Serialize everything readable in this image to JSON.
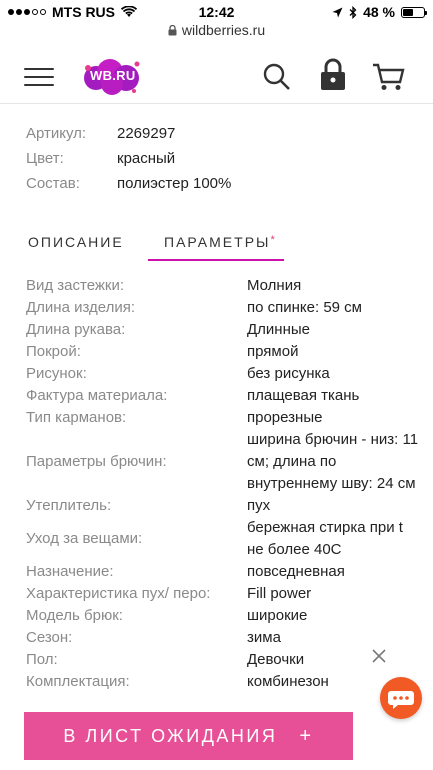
{
  "status_bar": {
    "carrier": "MTS RUS",
    "time": "12:42",
    "battery": "48 %",
    "battery_level": 0.48
  },
  "browser": {
    "url": "wildberries.ru"
  },
  "header": {
    "logo_text": "WB.RU"
  },
  "specs": [
    {
      "label": "Артикул:",
      "value": "2269297"
    },
    {
      "label": "Цвет:",
      "value": "красный"
    },
    {
      "label": "Состав:",
      "value": "полиэстер 100%"
    }
  ],
  "tabs": {
    "description": "ОПИСАНИЕ",
    "parameters": "ПАРАМЕТРЫ",
    "parameters_marker": "*"
  },
  "params": [
    {
      "label": "Вид застежки:",
      "value": "Молния"
    },
    {
      "label": "Длина изделия:",
      "value": "по спинке: 59 см"
    },
    {
      "label": "Длина рукава:",
      "value": "Длинные"
    },
    {
      "label": "Покрой:",
      "value": "прямой"
    },
    {
      "label": "Рисунок:",
      "value": "без рисунка"
    },
    {
      "label": "Фактура материала:",
      "value": "плащевая ткань"
    },
    {
      "label": "Тип карманов:",
      "value": "прорезные"
    },
    {
      "label": "Параметры брючин:",
      "value": "ширина брючин - низ: 11 см; длина по внутреннему шву: 24 см"
    },
    {
      "label": "Утеплитель:",
      "value": "пух"
    },
    {
      "label": "Уход за вещами:",
      "value": "бережная стирка при t не более 40С"
    },
    {
      "label": "Назначение:",
      "value": "повседневная"
    },
    {
      "label": "Характеристика пух/ перо:",
      "value": "Fill power"
    },
    {
      "label": "Модель брюк:",
      "value": "широкие"
    },
    {
      "label": "Сезон:",
      "value": "зима"
    },
    {
      "label": "Пол:",
      "value": "Девочки"
    },
    {
      "label": "Комплектация:",
      "value": "комбинезон"
    }
  ],
  "actions": {
    "wishlist_label": "В ЛИСТ ОЖИДАНИЯ",
    "wishlist_plus": "+"
  },
  "colors": {
    "accent_pink": "#e75097",
    "tab_underline": "#cb11ab",
    "chat_orange": "#f15a24",
    "logo_purple": "#a21cbf"
  }
}
